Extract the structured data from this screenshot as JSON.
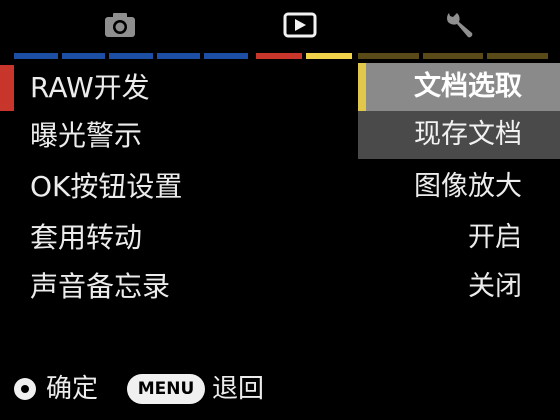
{
  "tabs": [
    {
      "id": "camera",
      "icon": "camera-icon",
      "active": false
    },
    {
      "id": "playback",
      "icon": "playback-icon",
      "active": true
    },
    {
      "id": "setup",
      "icon": "wrench-icon",
      "active": false
    }
  ],
  "colors": {
    "strip_camera": [
      "#1c4fa3",
      "#1c4fa3",
      "#1c4fa3",
      "#1c4fa3",
      "#1c4fa3"
    ],
    "strip_play": [
      "#c8362b",
      "#f0d24a"
    ],
    "strip_setup": [
      "#5a4a18",
      "#5a4a18",
      "#5a4a18"
    ],
    "marker": "#c8362b",
    "submenu_accent": "#e2c84a"
  },
  "menu": {
    "items": [
      {
        "label": "RAW开发",
        "value": ""
      },
      {
        "label": "曝光警示",
        "value": ""
      },
      {
        "label": "OK按钮设置",
        "value": "图像放大"
      },
      {
        "label": "套用转动",
        "value": "开启"
      },
      {
        "label": "声音备忘录",
        "value": "关闭"
      }
    ]
  },
  "submenu": {
    "options": [
      "文档选取",
      "现存文档"
    ],
    "selected": "文档选取"
  },
  "footer": {
    "ok_label": "确定",
    "menu_key": "MENU",
    "back_label": "退回"
  }
}
